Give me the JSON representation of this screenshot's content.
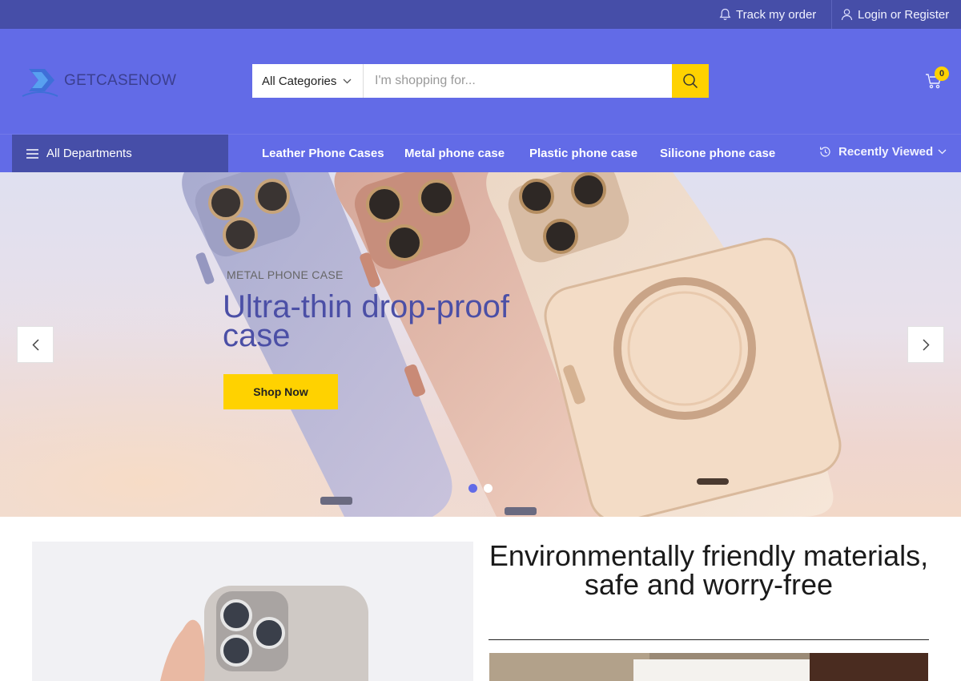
{
  "topbar": {
    "track_order": "Track my order",
    "login_register": "Login or Register"
  },
  "header": {
    "logo_text": "GETCASENOW",
    "search": {
      "category": "All Categories",
      "placeholder": "I'm shopping for..."
    },
    "cart": {
      "count": "0"
    }
  },
  "nav": {
    "departments_label": "All Departments",
    "links": [
      "Leather Phone Cases",
      "Metal phone case",
      "Plastic phone case",
      "Silicone phone case"
    ],
    "recently_viewed": "Recently Viewed"
  },
  "hero": {
    "kicker": "METAL PHONE CASE",
    "title": "Ultra-thin drop-proof case",
    "button": "Shop Now",
    "slide_count": 2,
    "active_slide": 1
  },
  "promo": {
    "title": "Environmentally friendly materials, safe and worry-free"
  },
  "colors": {
    "topbar": "#464ea8",
    "header": "#626be7",
    "accent": "#ffd200",
    "hero_title": "#4b4fa6"
  }
}
